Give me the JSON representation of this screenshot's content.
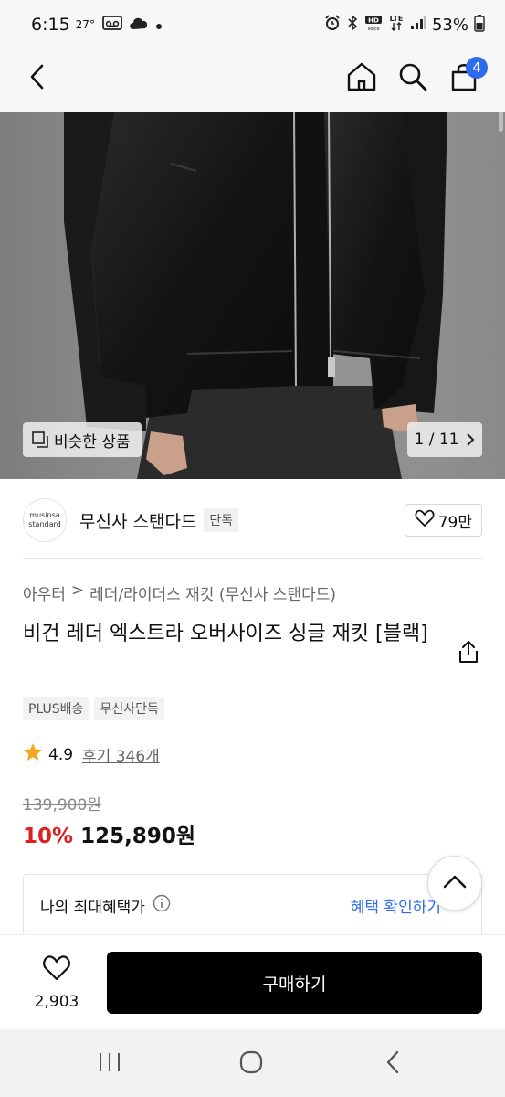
{
  "status_bar": {
    "time": "6:15",
    "temperature": "27°",
    "battery": "53%",
    "icons": [
      "voicemail-icon",
      "cloud-icon",
      "dot-icon",
      "alarm-icon",
      "bluetooth-icon",
      "hd-voice-icon",
      "lte-icon",
      "signal-icon",
      "battery-icon"
    ]
  },
  "header": {
    "cart_count": "4",
    "icons": [
      "back-icon",
      "home-icon",
      "search-icon",
      "cart-icon"
    ]
  },
  "gallery": {
    "similar_label": "비슷한 상품",
    "counter": "1 / 11"
  },
  "brand": {
    "logo_line1": "musinsa",
    "logo_line2": "standard",
    "name": "무신사 스탠다드",
    "exclusive_tag": "단독",
    "likes": "79만"
  },
  "breadcrumb": {
    "category": "아우터",
    "separator": ">",
    "subcategory": "레더/라이더스 재킷 (무신사 스탠다드)"
  },
  "product": {
    "title": "비건 레더 엑스트라 오버사이즈 싱글 재킷 [블랙]",
    "chips": [
      "PLUS배송",
      "무신사단독"
    ],
    "rating": "4.9",
    "reviews": "후기 346개",
    "original_price": "139,900원",
    "discount": "10%",
    "sale_price": "125,890원"
  },
  "benefit": {
    "label": "나의 최대혜택가",
    "link": "혜택 확인하기"
  },
  "bottom_bar": {
    "wish_count": "2,903",
    "buy_label": "구매하기"
  },
  "colors": {
    "accent_blue": "#2e6bef",
    "discount_red": "#e02020",
    "buy_button": "#000000"
  }
}
